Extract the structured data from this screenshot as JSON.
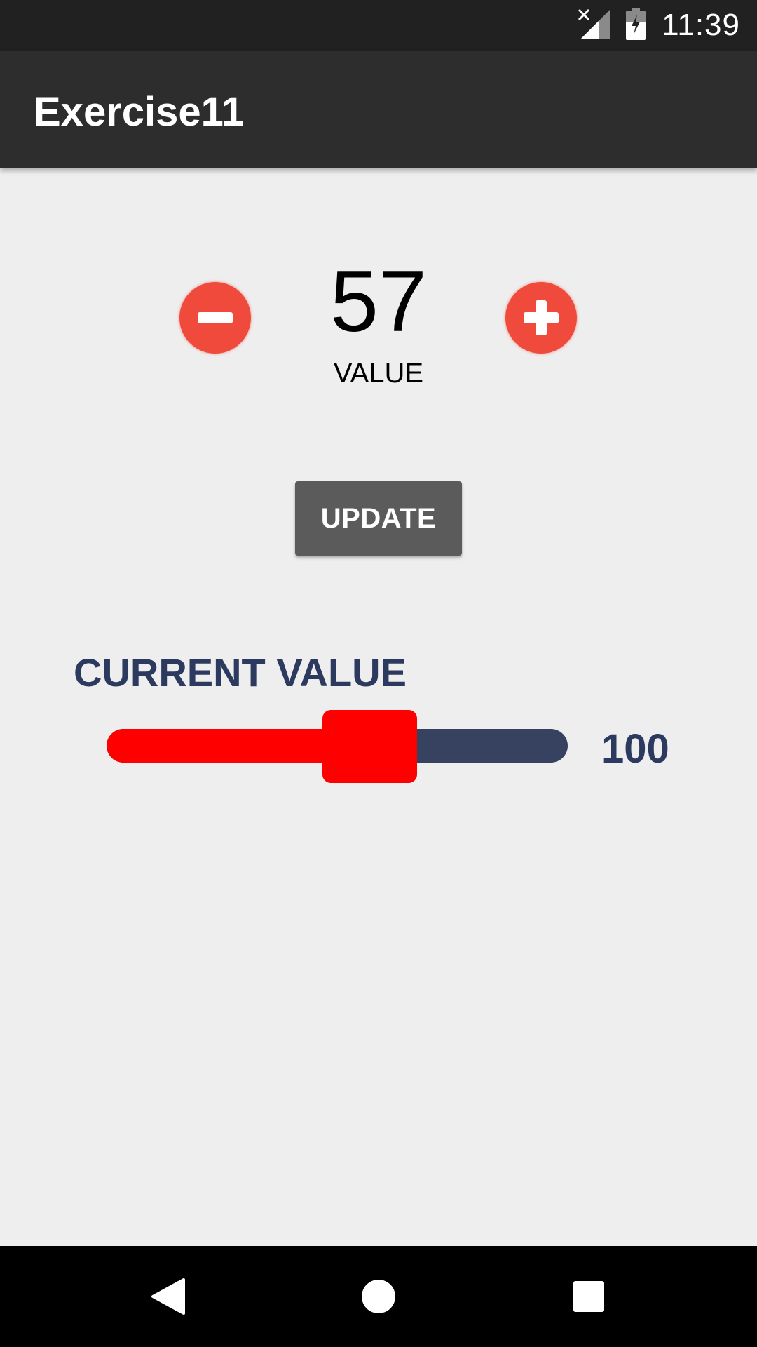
{
  "status_bar": {
    "time": "11:39",
    "icons": [
      "signal-off-icon",
      "battery-charging-icon"
    ]
  },
  "app_bar": {
    "title": "Exercise11"
  },
  "counter": {
    "value": "57",
    "label": "VALUE",
    "decrement_icon": "minus-circle-icon",
    "increment_icon": "plus-circle-icon",
    "accent_color": "#ef4a3c"
  },
  "update_button": {
    "label": "UPDATE",
    "color": "#5b5b5b"
  },
  "current_value": {
    "title": "CURRENT VALUE",
    "max_label": "100",
    "slider_fraction": 0.57,
    "fill_color": "#ff0000",
    "track_color": "#36425f",
    "text_color": "#2b3a5e"
  },
  "nav_bar": {
    "icons": [
      "back-icon",
      "home-icon",
      "recents-icon"
    ]
  }
}
